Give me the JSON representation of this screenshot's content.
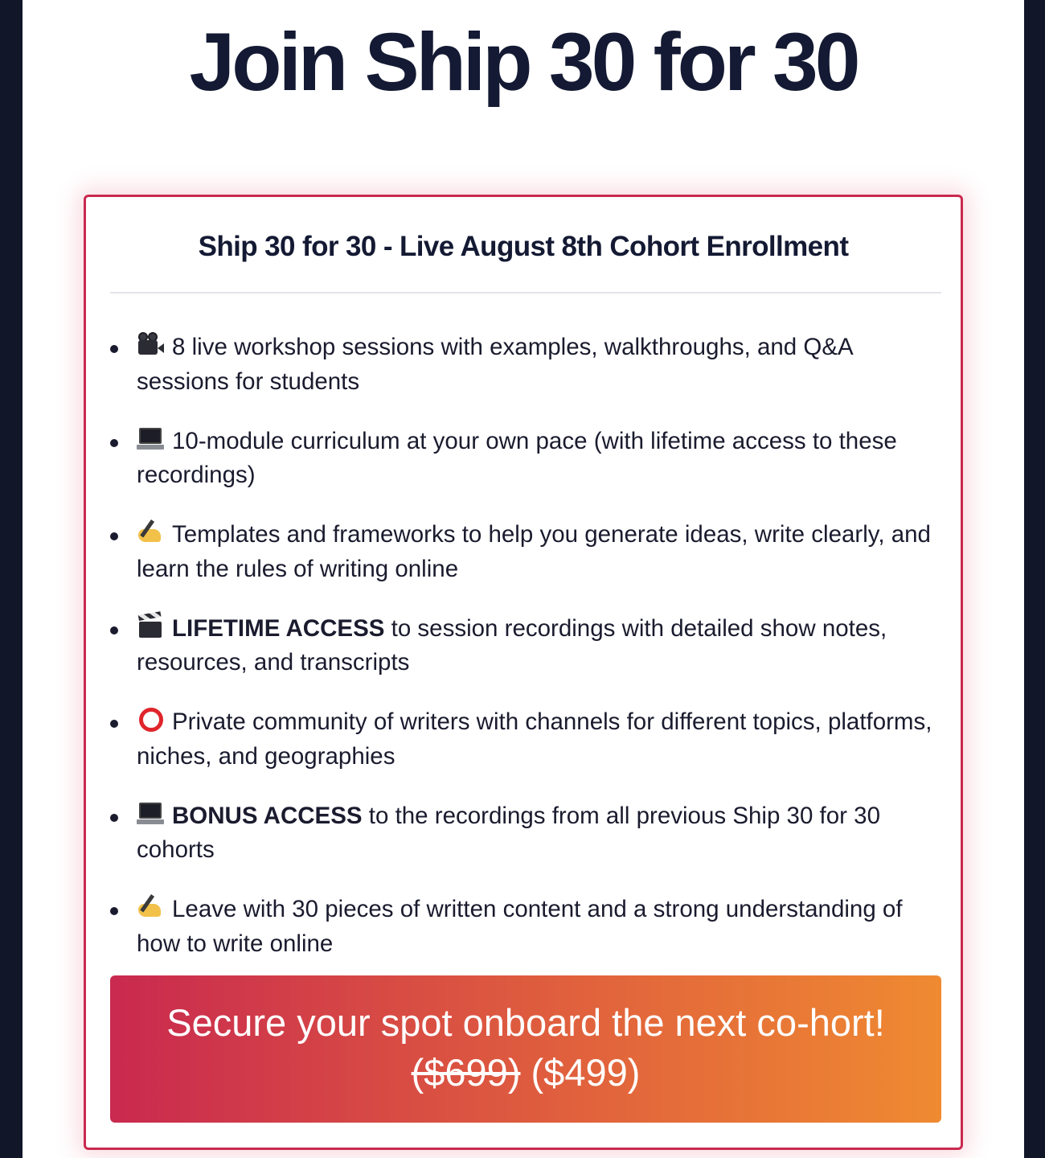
{
  "page": {
    "title": "Join Ship 30 for 30"
  },
  "card": {
    "title": "Ship 30 for 30 - Live August 8th Cohort Enrollment",
    "features": [
      {
        "icon": "movie-camera-icon",
        "bold": "",
        "text": "8 live workshop sessions with examples, walkthroughs, and Q&A sessions for students"
      },
      {
        "icon": "laptop-icon",
        "bold": "",
        "text": "10-module curriculum at your own pace (with lifetime access to these recordings)"
      },
      {
        "icon": "writing-hand-icon",
        "bold": "",
        "text": "Templates and frameworks to help you generate ideas, write clearly, and learn the rules of writing online"
      },
      {
        "icon": "clapper-board-icon",
        "bold": "LIFETIME ACCESS",
        "text": " to session recordings with detailed show notes, resources, and transcripts"
      },
      {
        "icon": "hollow-red-circle-icon",
        "bold": "",
        "text": "Private community of writers with channels for different topics, platforms, niches, and geographies"
      },
      {
        "icon": "laptop-icon",
        "bold": "BONUS ACCESS",
        "text": " to the recordings from all previous Ship 30 for 30 cohorts"
      },
      {
        "icon": "writing-hand-icon",
        "bold": "",
        "text": "Leave with 30 pieces of written content and a strong understanding of how to write online"
      }
    ],
    "cta": {
      "label": "Secure your spot onboard the next co-hort!",
      "old_price": "($699)",
      "new_price": "($499)"
    }
  },
  "colors": {
    "page_background": "#111629",
    "card_border": "#c9294f",
    "cta_gradient_start": "#c9294f",
    "cta_gradient_end": "#ef8a31",
    "title_text": "#141a33"
  }
}
